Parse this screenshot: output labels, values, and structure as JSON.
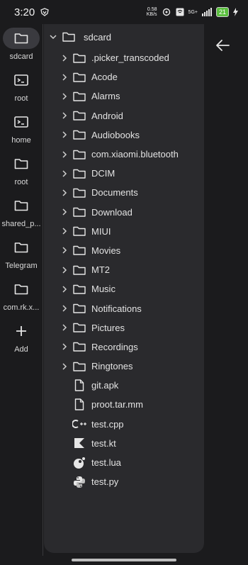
{
  "status_bar": {
    "time": "3:20",
    "net_speed_value": "0.58",
    "net_speed_unit": "KB/s",
    "network_type": "5G+",
    "battery": "21"
  },
  "rail": {
    "items": [
      {
        "label": "sdcard",
        "icon": "folder-icon"
      },
      {
        "label": "root",
        "icon": "terminal-icon"
      },
      {
        "label": "home",
        "icon": "terminal-icon"
      },
      {
        "label": "root",
        "icon": "folder-icon"
      },
      {
        "label": "shared_p...",
        "icon": "folder-icon"
      },
      {
        "label": "Telegram",
        "icon": "folder-icon"
      },
      {
        "label": "com.rk.x...",
        "icon": "folder-icon"
      }
    ],
    "add_label": "Add"
  },
  "tree": {
    "root_label": "sdcard",
    "folders": [
      ".picker_transcoded",
      "Acode",
      "Alarms",
      "Android",
      "Audiobooks",
      "com.xiaomi.bluetooth",
      "DCIM",
      "Documents",
      "Download",
      "MIUI",
      "Movies",
      "MT2",
      "Music",
      "Notifications",
      "Pictures",
      "Recordings",
      "Ringtones"
    ],
    "files": [
      {
        "name": "git.apk",
        "icon": "file-icon"
      },
      {
        "name": "proot.tar.mm",
        "icon": "file-icon"
      },
      {
        "name": "test.cpp",
        "icon": "cpp-icon"
      },
      {
        "name": "test.kt",
        "icon": "kotlin-icon"
      },
      {
        "name": "test.lua",
        "icon": "lua-icon"
      },
      {
        "name": "test.py",
        "icon": "python-icon"
      }
    ]
  }
}
